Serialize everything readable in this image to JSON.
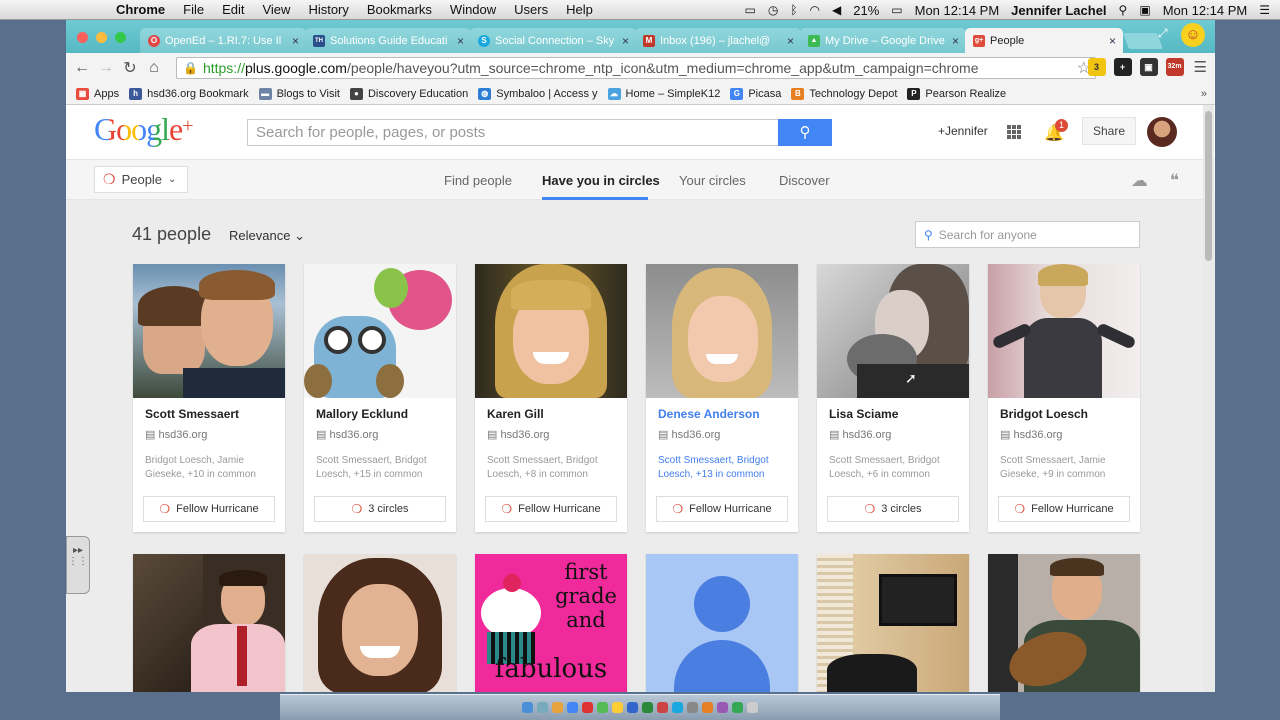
{
  "menubar": {
    "app": "Chrome",
    "items": [
      "File",
      "Edit",
      "View",
      "History",
      "Bookmarks",
      "Window",
      "Users",
      "Help"
    ],
    "battery": "21%",
    "clock": "Mon 12:14 PM",
    "user": "Jennifer Lachel",
    "clock2": "Mon 12:14 PM"
  },
  "tabs": [
    {
      "title": "OpenEd – 1.RI.7: Use Il",
      "fav_color": "#e04848",
      "fav": "O"
    },
    {
      "title": "Solutions Guide Educati",
      "fav_color": "#2a4f8a",
      "fav": "TH"
    },
    {
      "title": "Social Connection – Sky",
      "fav_color": "#1aa8e0",
      "fav": "S"
    },
    {
      "title": "Inbox (196) – jlachel@",
      "fav_color": "#c0392b",
      "fav": "M"
    },
    {
      "title": "My Drive – Google Drive",
      "fav_color": "#3cba54",
      "fav": "▲"
    },
    {
      "title": "People",
      "fav_color": "#dd4b39",
      "fav": "g+"
    }
  ],
  "url": {
    "scheme": "https://",
    "host": "plus.google.com",
    "path": "/people/haveyou?utm_source=chrome_ntp_icon&utm_medium=chrome_app&utm_campaign=chrome"
  },
  "extensions": [
    {
      "label": "3",
      "color": "#f1c40f"
    },
    {
      "label": "+",
      "color": "#222"
    },
    {
      "label": "▣",
      "color": "#333"
    },
    {
      "label": "32m",
      "color": "#c0392b"
    }
  ],
  "bookmarks": [
    {
      "label": "Apps",
      "color": "#e74c3c",
      "ico": "▦"
    },
    {
      "label": "hsd36.org Bookmark",
      "color": "#3b5998",
      "ico": "h"
    },
    {
      "label": "Blogs to Visit",
      "color": "#6d84a4",
      "ico": "▬"
    },
    {
      "label": "Discovery Education",
      "color": "#444",
      "ico": "●"
    },
    {
      "label": "Symbaloo | Access y",
      "color": "#2d7dd2",
      "ico": "◍"
    },
    {
      "label": "Home – SimpleK12",
      "color": "#4aa3df",
      "ico": "☁"
    },
    {
      "label": "Picasa",
      "color": "#4285f4",
      "ico": "G"
    },
    {
      "label": "Technology Depot",
      "color": "#e67e22",
      "ico": "B"
    },
    {
      "label": "Pearson Realize",
      "color": "#222",
      "ico": "P"
    }
  ],
  "gplus": {
    "logo_main": "Google",
    "logo_plus": "+",
    "search_placeholder": "Search for people, pages, or posts",
    "user": "+Jennifer",
    "notifications": "1",
    "share": "Share"
  },
  "subnav": {
    "people": "People",
    "tabs": [
      "Find people",
      "Have you in circles",
      "Your circles",
      "Discover"
    ]
  },
  "list": {
    "count": "41 people",
    "sort": "Relevance",
    "search_placeholder": "Search for anyone"
  },
  "cards": [
    {
      "name": "Scott Smessaert",
      "org": "hsd36.org",
      "common": "Bridgot Loesch, Jamie Gieseke, +10 in common",
      "button": "Fellow Hurricane",
      "highlight": false
    },
    {
      "name": "Mallory Ecklund",
      "org": "hsd36.org",
      "common": "Scott Smessaert, Bridgot Loesch, +15 in common",
      "button": "3 circles",
      "highlight": false
    },
    {
      "name": "Karen Gill",
      "org": "hsd36.org",
      "common": "Scott Smessaert, Bridgot Loesch, +8 in common",
      "button": "Fellow Hurricane",
      "highlight": false
    },
    {
      "name": "Denese Anderson",
      "org": "hsd36.org",
      "common": "Scott Smessaert, Bridgot Loesch, +13 in common",
      "button": "Fellow Hurricane",
      "highlight": true
    },
    {
      "name": "Lisa Sciame",
      "org": "hsd36.org",
      "common": "Scott Smessaert, Bridgot Loesch, +6 in common",
      "button": "3 circles",
      "highlight": false
    },
    {
      "name": "Bridgot Loesch",
      "org": "hsd36.org",
      "common": "Scott Smessaert, Jamie Gieseke, +9 in common",
      "button": "Fellow Hurricane",
      "highlight": false
    }
  ],
  "row2_text": {
    "grade_line1": "first",
    "grade_line2": "grade",
    "grade_line3": "and",
    "grade_line4": "fabulous"
  }
}
